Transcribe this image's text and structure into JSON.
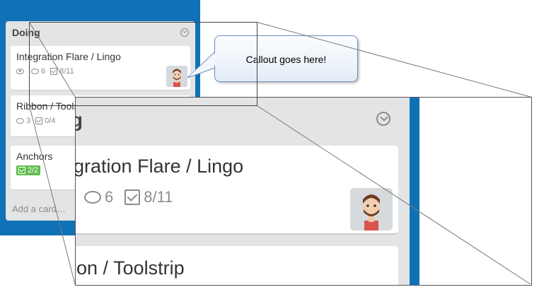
{
  "board": {
    "list_title": "Doing",
    "cards": [
      {
        "title": "Integration Flare / Lingo",
        "watch": true,
        "comments": "6",
        "checklist": "8/11",
        "has_avatar": true
      },
      {
        "title": "Ribbon / Toolstrip",
        "comments": "3",
        "checklist": "0/4"
      },
      {
        "title": "Anchors",
        "checklist_done": "2/2"
      }
    ],
    "add_card": "Add a card…"
  },
  "callout": {
    "text": "Callout goes here!"
  },
  "magnifier": {
    "list_title_fragment": "ing",
    "card1_title_fragment": "egration Flare / Lingo",
    "card1_comments": "6",
    "card1_checklist": "8/11",
    "card2_title_fragment": "bon / Toolstrip"
  },
  "colors": {
    "board_blue": "#0f72b6",
    "list_gray": "#e3e4e6",
    "done_green": "#61bd4f",
    "callout_border": "#6f8fbf"
  },
  "icons": [
    "eye-icon",
    "comment-icon",
    "checklist-icon",
    "list-menu-chevron-icon",
    "avatar-image"
  ]
}
